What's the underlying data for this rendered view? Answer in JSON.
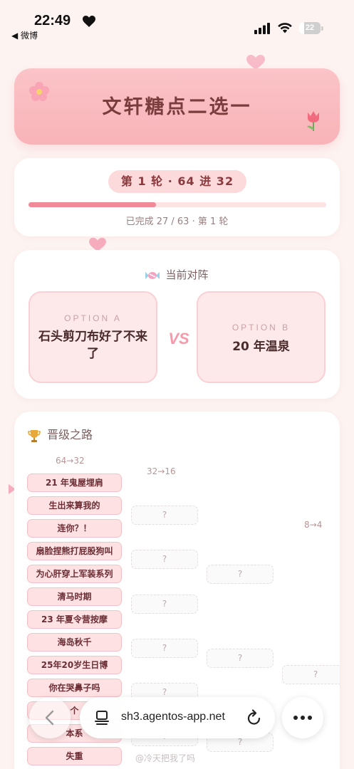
{
  "status_bar": {
    "time": "22:49",
    "back_app": "◀ 微博",
    "battery_level": "22"
  },
  "header": {
    "title": "文轩糖点二选一"
  },
  "progress": {
    "round_label": "第 1 轮 · 64 进 32",
    "completed": 27,
    "total": 63,
    "text": "已完成 27 / 63 · 第 1 轮"
  },
  "matchup": {
    "heading": "当前对阵",
    "option_a_tag": "OPTION A",
    "option_a_name": "石头剪刀布好了不来了",
    "vs": "VS",
    "option_b_tag": "OPTION B",
    "option_b_name": "20 年温泉"
  },
  "bracket": {
    "heading": "晋级之路",
    "columns": [
      "64→32",
      "32→16",
      "8→4"
    ],
    "entries": [
      "21 年鬼屋埋肩",
      "生出来算我的",
      "连你？！",
      "扇脸捏熊打屁股狗叫",
      "为心肝穿上军装系列",
      "清马时期",
      "23 年夏令营按摩",
      "海岛秋千",
      "25年20岁生日博",
      "你在哭鼻子吗",
      "个",
      "本系",
      "失重"
    ],
    "placeholder": "?"
  },
  "browser": {
    "url": "sh3.agentos-app.net"
  },
  "watermark": "@冷天把我了吗",
  "colors": {
    "accent": "#f08a98",
    "title_card": "#f8b3b8",
    "entry_bg": "#fde1e3"
  }
}
